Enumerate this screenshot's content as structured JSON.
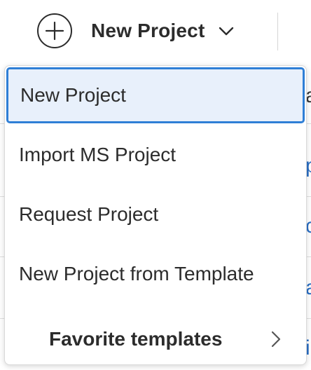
{
  "toolbar": {
    "trigger_label": "New Project",
    "trigger_icon": "plus-circle-icon",
    "caret_icon": "chevron-down-icon"
  },
  "background_peek": [
    "a",
    "p",
    "c",
    "a",
    "i"
  ],
  "menu": {
    "items": [
      {
        "label": "New Project",
        "selected": true
      },
      {
        "label": "Import MS Project",
        "selected": false
      },
      {
        "label": "Request Project",
        "selected": false
      },
      {
        "label": "New Project from Template",
        "selected": false
      }
    ],
    "favorites": {
      "label": "Favorite templates",
      "icon": "chevron-right-icon"
    }
  },
  "colors": {
    "selection_border": "#2f7fd6",
    "selection_fill": "#e8f0fb",
    "text": "#2c2c2c",
    "link_peek": "#2b6fc4"
  }
}
